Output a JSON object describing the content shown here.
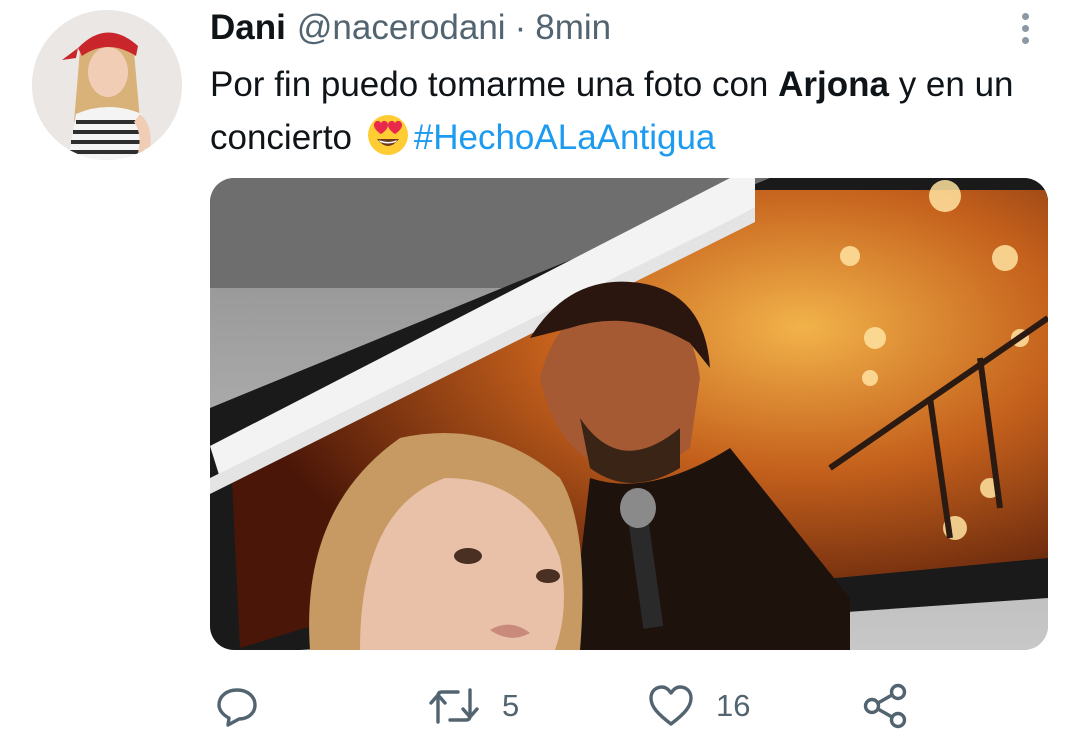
{
  "tweet": {
    "display_name": "Dani",
    "handle": "@nacerodani",
    "separator": "·",
    "time": "8min",
    "text": {
      "part1": "Por fin puedo tomarme una foto con ",
      "bold": "Arjona",
      "part2": " y en un concierto ",
      "emoji": "smiling-face-with-heart-eyes",
      "hashtag": "#HechoALaAntigua"
    },
    "media": {
      "description_icon": "photo"
    }
  },
  "actions": {
    "reply_count": "",
    "retweet_count": "5",
    "like_count": "16"
  },
  "icons": {
    "more": "more-vertical-icon",
    "reply": "reply-icon",
    "retweet": "retweet-icon",
    "like": "heart-icon",
    "share": "share-icon"
  },
  "colors": {
    "accent": "#1d9bf0",
    "secondary_text": "#536471",
    "primary_text": "#0f1419"
  }
}
